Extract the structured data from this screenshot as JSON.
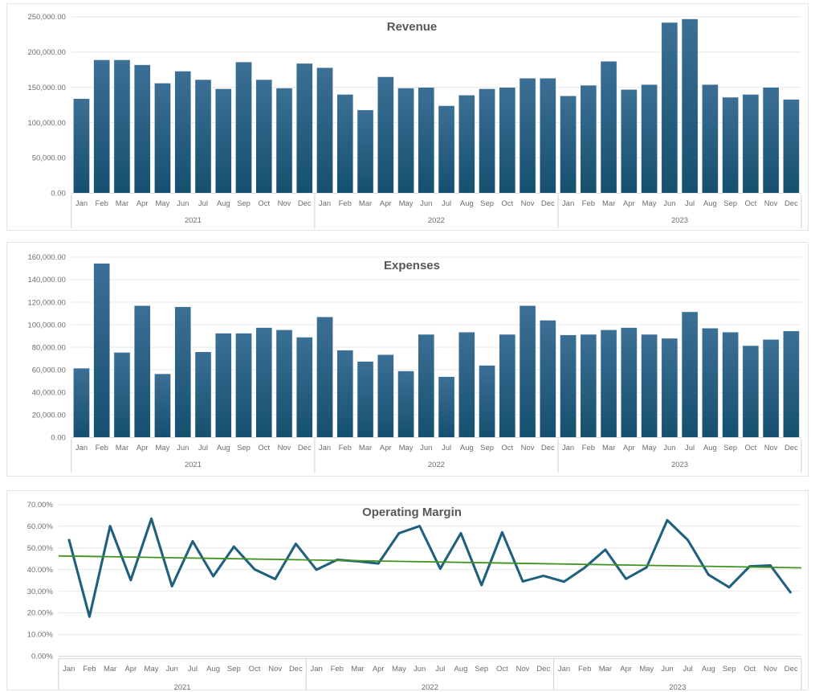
{
  "colors": {
    "bar_top": "#3c6f95",
    "bar_bottom": "#15506e",
    "line": "#1f6080",
    "trend": "#3f9321",
    "title": "#575757",
    "tick": "#6d6d6d",
    "grid": "#e8e8e8",
    "panel_border": "#e3e3e3",
    "background": "#ffffff"
  },
  "panels": [
    {
      "name": "revenue",
      "title": "Revenue"
    },
    {
      "name": "expenses",
      "title": "Expenses"
    },
    {
      "name": "margin",
      "title": "Operating Margin"
    }
  ],
  "chart_data": [
    {
      "type": "bar",
      "title": "Revenue",
      "xlabel": "",
      "ylabel": "",
      "ylim": [
        0,
        250000
      ],
      "yticks": [
        0,
        50000,
        100000,
        150000,
        200000,
        250000
      ],
      "ytick_labels": [
        "0.00",
        "50,000.00",
        "100,000.00",
        "150,000.00",
        "200,000.00",
        "250,000.00"
      ],
      "grid": true,
      "legend": "none",
      "group_labels": [
        "2021",
        "2022",
        "2023"
      ],
      "categories": [
        "Jan",
        "Feb",
        "Mar",
        "Apr",
        "May",
        "Jun",
        "Jul",
        "Aug",
        "Sep",
        "Oct",
        "Nov",
        "Dec"
      ],
      "groups": [
        {
          "label": "2021",
          "values": [
            134000,
            189000,
            189000,
            182000,
            156000,
            173000,
            161000,
            148000,
            186000,
            161000,
            149000,
            184000
          ]
        },
        {
          "label": "2022",
          "values": [
            178000,
            140000,
            118000,
            165000,
            149000,
            150000,
            124000,
            139000,
            148000,
            150000,
            163000,
            163000
          ]
        },
        {
          "label": "2023",
          "values": [
            138000,
            153000,
            187000,
            147000,
            154000,
            242000,
            247000,
            154000,
            136000,
            140000,
            150000,
            133000
          ]
        }
      ]
    },
    {
      "type": "bar",
      "title": "Expenses",
      "xlabel": "",
      "ylabel": "",
      "ylim": [
        0,
        160000
      ],
      "yticks": [
        0,
        20000,
        40000,
        60000,
        80000,
        100000,
        120000,
        140000,
        160000
      ],
      "ytick_labels": [
        "0.00",
        "20,000.00",
        "40,000.00",
        "60,000.00",
        "80,000.00",
        "100,000.00",
        "120,000.00",
        "140,000.00",
        "160,000.00"
      ],
      "grid": true,
      "legend": "none",
      "group_labels": [
        "2021",
        "2022",
        "2023"
      ],
      "categories": [
        "Jan",
        "Feb",
        "Mar",
        "Apr",
        "May",
        "Jun",
        "Jul",
        "Aug",
        "Sep",
        "Oct",
        "Nov",
        "Dec"
      ],
      "groups": [
        {
          "label": "2021",
          "values": [
            61500,
            154500,
            75500,
            117000,
            56500,
            116000,
            76000,
            92500,
            92500,
            97500,
            95500,
            89000
          ]
        },
        {
          "label": "2022",
          "values": [
            107000,
            77500,
            67500,
            73500,
            59000,
            91500,
            54000,
            93500,
            64000,
            91500,
            117000,
            104000
          ]
        },
        {
          "label": "2023",
          "values": [
            91000,
            91500,
            95500,
            97500,
            91500,
            88000,
            111500,
            97000,
            93500,
            81500,
            87000,
            94500
          ]
        }
      ]
    },
    {
      "type": "line",
      "title": "Operating Margin",
      "xlabel": "",
      "ylabel": "",
      "ylim": [
        0,
        0.7
      ],
      "yticks": [
        0,
        0.1,
        0.2,
        0.3,
        0.4,
        0.5,
        0.6,
        0.7
      ],
      "ytick_labels": [
        "0.00%",
        "10.00%",
        "20.00%",
        "30.00%",
        "40.00%",
        "50.00%",
        "60.00%",
        "70.00%"
      ],
      "grid": true,
      "legend": "none",
      "group_labels": [
        "2021",
        "2022",
        "2023"
      ],
      "categories": [
        "Jan",
        "Feb",
        "Mar",
        "Apr",
        "May",
        "Jun",
        "Jul",
        "Aug",
        "Sep",
        "Oct",
        "Nov",
        "Dec"
      ],
      "series": [
        {
          "name": "Operating Margin",
          "groups": [
            {
              "label": "2021",
              "values": [
                0.541,
                0.182,
                0.601,
                0.351,
                0.635,
                0.323,
                0.531,
                0.369,
                0.506,
                0.401,
                0.356,
                0.519
              ]
            },
            {
              "label": "2022",
              "values": [
                0.399,
                0.445,
                0.438,
                0.428,
                0.568,
                0.601,
                0.404,
                0.568,
                0.328,
                0.572,
                0.345,
                0.371
              ]
            },
            {
              "label": "2023",
              "values": [
                0.344,
                0.409,
                0.492,
                0.357,
                0.41,
                0.628,
                0.536,
                0.376,
                0.318,
                0.415,
                0.419,
                0.291
              ]
            }
          ]
        }
      ],
      "trendline": {
        "name": "Linear trend",
        "start": 0.463,
        "end": 0.408
      }
    }
  ]
}
